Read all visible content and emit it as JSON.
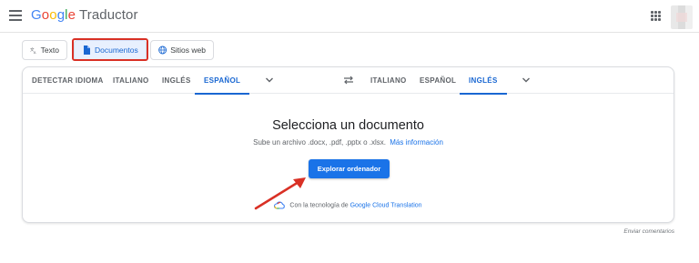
{
  "header": {
    "logo_parts": [
      "G",
      "o",
      "o",
      "g",
      "l",
      "e"
    ],
    "product": "Traductor"
  },
  "modes": [
    {
      "label": "Texto",
      "icon": "translate-icon",
      "active": false
    },
    {
      "label": "Documentos",
      "icon": "document-icon",
      "active": true
    },
    {
      "label": "Sitios web",
      "icon": "globe-icon",
      "active": false
    }
  ],
  "source_langs": [
    "DETECTAR IDIOMA",
    "ITALIANO",
    "INGLÉS",
    "ESPAÑOL"
  ],
  "target_langs": [
    "ITALIANO",
    "ESPAÑOL",
    "INGLÉS"
  ],
  "upload": {
    "title": "Selecciona un documento",
    "subtitle": "Sube un archivo .docx, .pdf, .pptx o .xlsx.",
    "more_info": "Más información",
    "button": "Explorar ordenador",
    "powered_prefix": "Con la tecnología de",
    "powered_link": "Google Cloud Translation"
  },
  "feedback": "Enviar comentarios",
  "colors": {
    "accent": "#1a73e8",
    "annotation": "#d93025"
  }
}
